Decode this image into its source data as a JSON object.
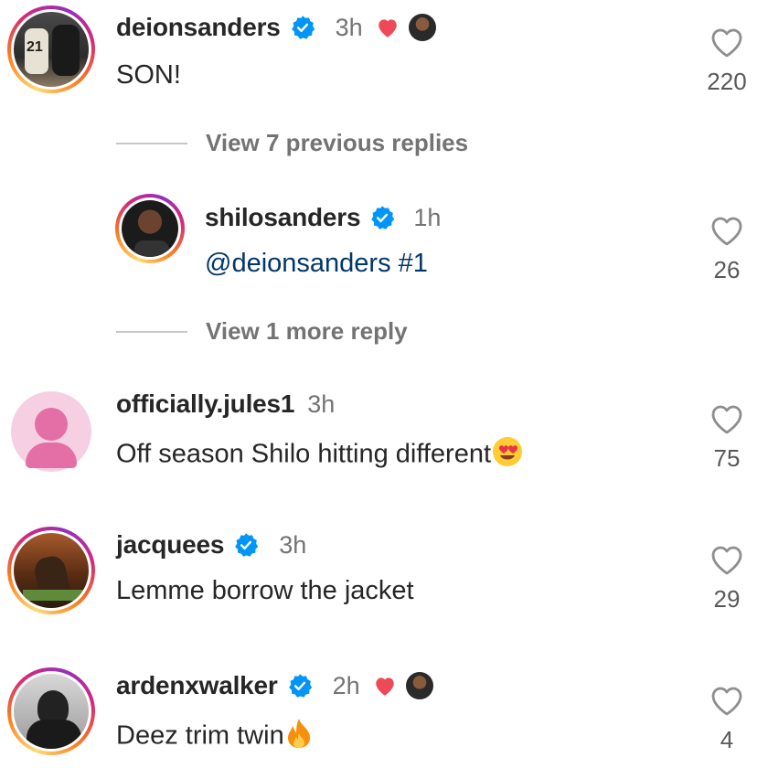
{
  "comments": [
    {
      "username": "deionsanders",
      "verified": true,
      "time": "3h",
      "liked_by_author": true,
      "text": "SON!",
      "likes": "220",
      "avatar": "football-players-photo"
    },
    {
      "username": "shilosanders",
      "verified": true,
      "time": "1h",
      "mention": "@deionsanders",
      "text": " #1",
      "likes": "26",
      "avatar": "portrait-photo"
    },
    {
      "username": "officially.jules1",
      "verified": false,
      "time": "3h",
      "text": "Off season Shilo hitting different",
      "likes": "75",
      "avatar": "default-avatar"
    },
    {
      "username": "jacquees",
      "verified": true,
      "time": "3h",
      "text": "Lemme borrow the jacket",
      "likes": "29",
      "avatar": "statue-photo"
    },
    {
      "username": "ardenxwalker",
      "verified": true,
      "time": "2h",
      "liked_by_author": true,
      "text": "Deez trim twin",
      "likes": "4",
      "avatar": "hooded-figure-photo"
    }
  ],
  "view_previous_replies": "View 7 previous replies",
  "view_more_reply": "View 1 more reply",
  "colors": {
    "verified": "#0095f6",
    "heart_red": "#ed4956",
    "mention": "#00376b",
    "secondary_text": "#737373"
  }
}
